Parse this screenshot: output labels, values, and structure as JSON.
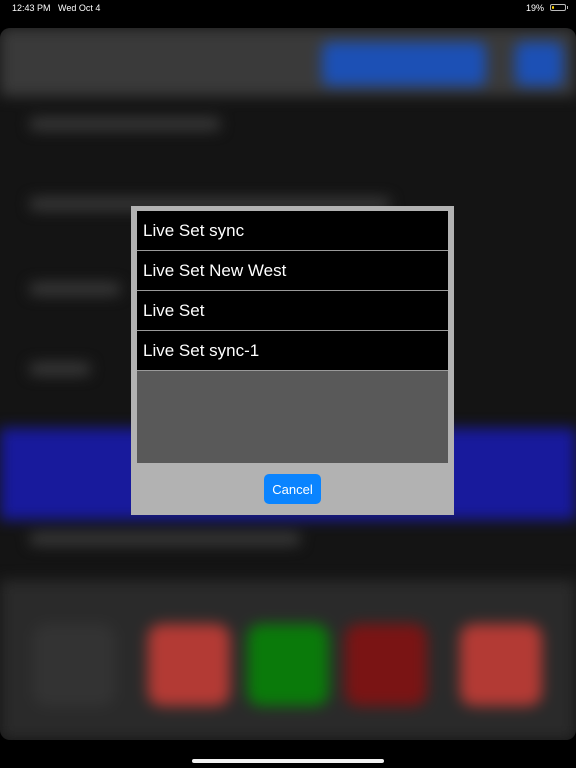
{
  "status_bar": {
    "time": "12:43 PM",
    "date": "Wed Oct 4",
    "battery_percent": "19%",
    "battery_level": 0.19
  },
  "dialog": {
    "items": [
      {
        "label": "Live Set sync"
      },
      {
        "label": "Live Set New West"
      },
      {
        "label": "Live Set"
      },
      {
        "label": "Live Set sync-1"
      }
    ],
    "cancel_label": "Cancel"
  },
  "colors": {
    "accent": "#0a84ff",
    "dialog_bg": "#b2b2b2",
    "list_empty_bg": "#595959",
    "background_blue_band": "#181a9c"
  }
}
